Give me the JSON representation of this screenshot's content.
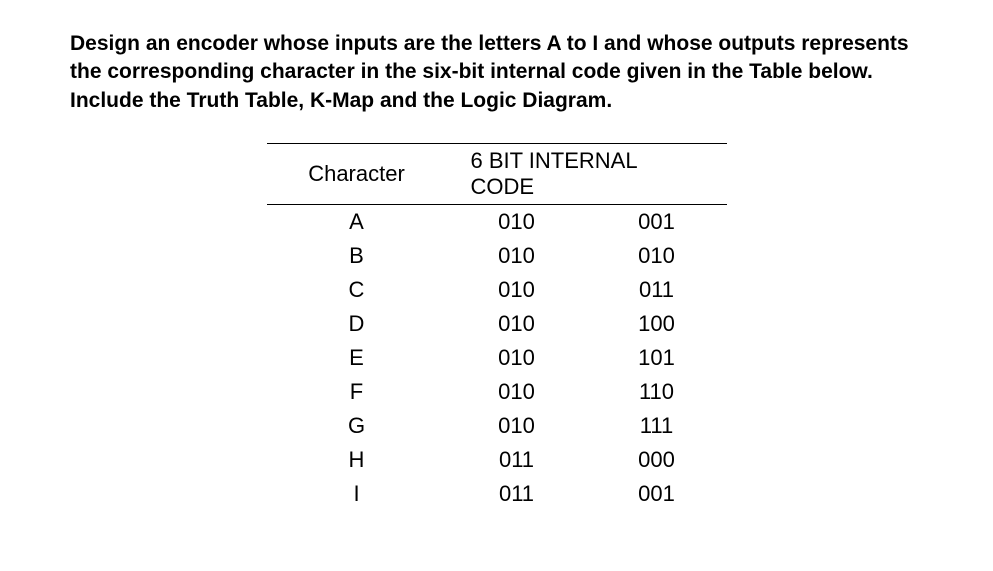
{
  "question": "Design an encoder whose inputs are the letters A to I and whose outputs represents the corresponding character in the six-bit internal code given in the Table below. Include the Truth Table, K-Map and the Logic Diagram.",
  "table": {
    "headers": {
      "character": "Character",
      "code": "6 BIT INTERNAL CODE"
    },
    "rows": [
      {
        "char": "A",
        "code_high": "010",
        "code_low": "001"
      },
      {
        "char": "B",
        "code_high": "010",
        "code_low": "010"
      },
      {
        "char": "C",
        "code_high": "010",
        "code_low": "011"
      },
      {
        "char": "D",
        "code_high": "010",
        "code_low": "100"
      },
      {
        "char": "E",
        "code_high": "010",
        "code_low": "101"
      },
      {
        "char": "F",
        "code_high": "010",
        "code_low": "110"
      },
      {
        "char": "G",
        "code_high": "010",
        "code_low": "111"
      },
      {
        "char": "H",
        "code_high": "011",
        "code_low": "000"
      },
      {
        "char": "I",
        "code_high": "011",
        "code_low": "001"
      }
    ]
  }
}
